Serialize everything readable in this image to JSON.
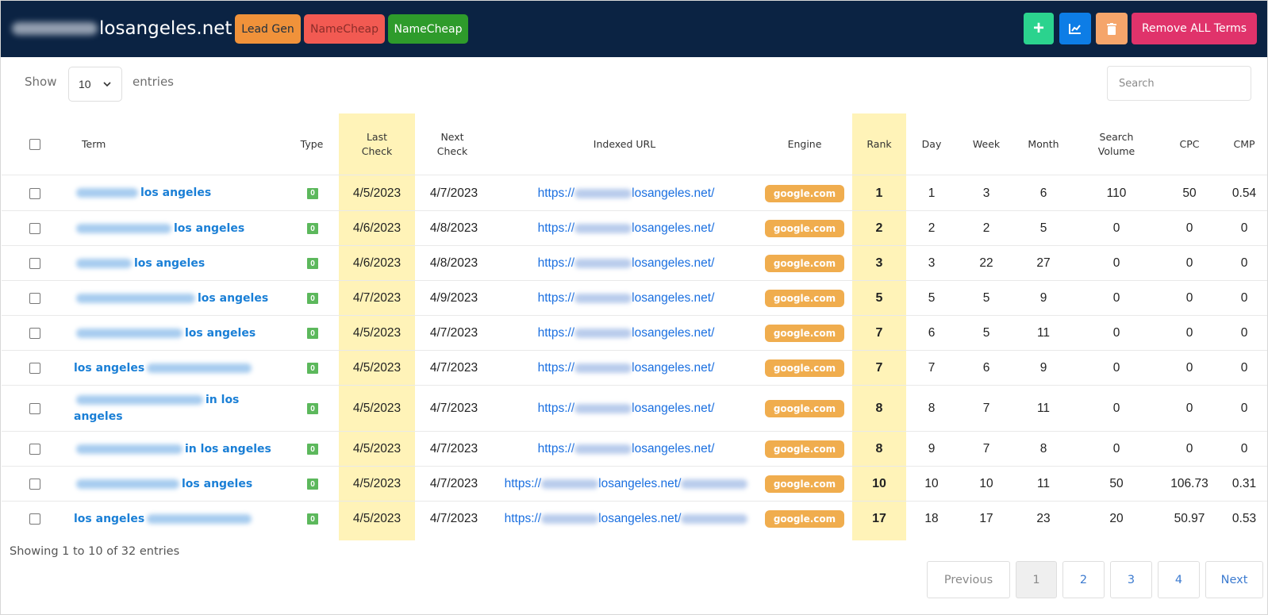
{
  "header": {
    "site_title_blurred": "ratrollllers",
    "site_title": "losangeles.net",
    "badges": {
      "lead_gen": "Lead Gen",
      "namecheap_1": "NameCheap",
      "namecheap_2": "NameCheap"
    },
    "buttons": {
      "add": "+",
      "remove_all": "Remove ALL Terms"
    },
    "colors": {
      "bar": "#0b2343",
      "lead_gen": "#f0923a",
      "namecheap_red": "#f25a52",
      "namecheap_green": "#2e9b2b",
      "add": "#2bd38e",
      "chart": "#0d7de6",
      "trash": "#f5a56b",
      "remove_all": "#e0336b"
    },
    "icons": [
      "plus-icon",
      "chart-line-icon",
      "trash-icon"
    ]
  },
  "controls": {
    "show_label": "Show",
    "entries_value": "10",
    "entries_label": "entries",
    "search_placeholder": "Search"
  },
  "table": {
    "columns": {
      "term": "Term",
      "type": "Type",
      "last_check": "Last Check",
      "next_check": "Next Check",
      "indexed_url": "Indexed URL",
      "engine": "Engine",
      "rank": "Rank",
      "day": "Day",
      "week": "Week",
      "month": "Month",
      "search_volume": "Search Volume",
      "cpc": "CPC",
      "cmp": "CMP"
    },
    "rows": [
      {
        "term_pre": "ratrollllers",
        "term": "los angeles",
        "term_post": "",
        "type": "0",
        "last_check": "4/5/2023",
        "next_check": "4/7/2023",
        "url_pre": "https://",
        "url_mid": "losangeles.net/",
        "url_post": "",
        "engine": "google.com",
        "rank": "1",
        "day": "1",
        "week": "3",
        "month": "6",
        "search_volume": "110",
        "cpc": "50",
        "cmp": "0.54"
      },
      {
        "term_pre": "ratrollll company",
        "term": "los angeles",
        "term_post": "",
        "type": "0",
        "last_check": "4/6/2023",
        "next_check": "4/8/2023",
        "url_pre": "https://",
        "url_mid": "losangeles.net/",
        "url_post": "",
        "engine": "google.com",
        "rank": "2",
        "day": "2",
        "week": "2",
        "month": "5",
        "search_volume": "0",
        "cpc": "0",
        "cmp": "0"
      },
      {
        "term_pre": "ratrollller",
        "term": "los angeles",
        "term_post": "",
        "type": "0",
        "last_check": "4/6/2023",
        "next_check": "4/8/2023",
        "url_pre": "https://",
        "url_mid": "losangeles.net/",
        "url_post": "",
        "engine": "google.com",
        "rank": "3",
        "day": "3",
        "week": "22",
        "month": "27",
        "search_volume": "0",
        "cpc": "0",
        "cmp": "0"
      },
      {
        "term_pre": "ratrollllling company",
        "term": "los angeles",
        "term_post": "",
        "type": "0",
        "last_check": "4/7/2023",
        "next_check": "4/9/2023",
        "url_pre": "https://",
        "url_mid": "losangeles.net/",
        "url_post": "",
        "engine": "google.com",
        "rank": "5",
        "day": "5",
        "week": "5",
        "month": "9",
        "search_volume": "0",
        "cpc": "0",
        "cmp": "0"
      },
      {
        "term_pre": "ratrollll companies",
        "term": "los angeles",
        "term_post": "",
        "type": "0",
        "last_check": "4/5/2023",
        "next_check": "4/7/2023",
        "url_pre": "https://",
        "url_mid": "losangeles.net/",
        "url_post": "",
        "engine": "google.com",
        "rank": "7",
        "day": "6",
        "week": "5",
        "month": "11",
        "search_volume": "0",
        "cpc": "0",
        "cmp": "0"
      },
      {
        "term_pre": "",
        "term": "los angeles",
        "term_post": "ratrollll companies",
        "type": "0",
        "last_check": "4/5/2023",
        "next_check": "4/7/2023",
        "url_pre": "https://",
        "url_mid": "losangeles.net/",
        "url_post": "",
        "engine": "google.com",
        "rank": "7",
        "day": "7",
        "week": "6",
        "month": "9",
        "search_volume": "0",
        "cpc": "0",
        "cmp": "0"
      },
      {
        "term_pre": "ratrollllling companies",
        "term": "in los angeles",
        "term_post": "",
        "type": "0",
        "last_check": "4/5/2023",
        "next_check": "4/7/2023",
        "url_pre": "https://",
        "url_mid": "losangeles.net/",
        "url_post": "",
        "engine": "google.com",
        "rank": "8",
        "day": "8",
        "week": "7",
        "month": "11",
        "search_volume": "0",
        "cpc": "0",
        "cmp": "0"
      },
      {
        "term_pre": "ratrollll companies",
        "term": "in los angeles",
        "term_post": "",
        "type": "0",
        "last_check": "4/5/2023",
        "next_check": "4/7/2023",
        "url_pre": "https://",
        "url_mid": "losangeles.net/",
        "url_post": "",
        "engine": "google.com",
        "rank": "8",
        "day": "9",
        "week": "7",
        "month": "8",
        "search_volume": "0",
        "cpc": "0",
        "cmp": "0"
      },
      {
        "term_pre": "ratrollll inspection",
        "term": "los angeles",
        "term_post": "",
        "type": "0",
        "last_check": "4/5/2023",
        "next_check": "4/7/2023",
        "url_pre": "https://",
        "url_mid": "losangeles.net/",
        "url_post": "inspections",
        "engine": "google.com",
        "rank": "10",
        "day": "10",
        "week": "10",
        "month": "11",
        "search_volume": "50",
        "cpc": "106.73",
        "cmp": "0.31"
      },
      {
        "term_pre": "",
        "term": "los angeles",
        "term_post": "ratrollll inspection",
        "type": "0",
        "last_check": "4/5/2023",
        "next_check": "4/7/2023",
        "url_pre": "https://",
        "url_mid": "losangeles.net/",
        "url_post": "inspections",
        "engine": "google.com",
        "rank": "17",
        "day": "18",
        "week": "17",
        "month": "23",
        "search_volume": "20",
        "cpc": "50.97",
        "cmp": "0.53"
      }
    ]
  },
  "footer": {
    "showing": "Showing 1 to 10 of 32 entries",
    "pagination": {
      "previous": "Previous",
      "pages": [
        "1",
        "2",
        "3",
        "4"
      ],
      "next": "Next"
    }
  }
}
